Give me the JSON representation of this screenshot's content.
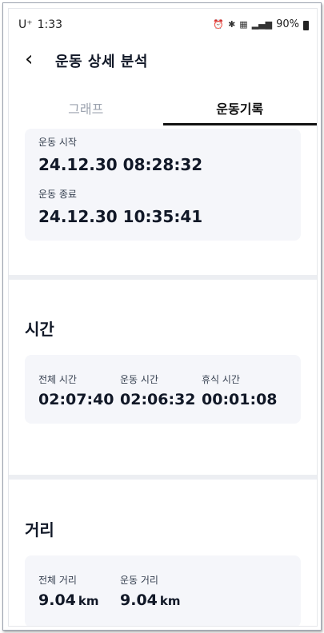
{
  "status_bar": {
    "carrier": "U⁺",
    "time": "1:33",
    "battery": "90%"
  },
  "header": {
    "title": "운동 상세 분석"
  },
  "tabs": [
    {
      "label": "그래프",
      "active": false
    },
    {
      "label": "운동기록",
      "active": true
    }
  ],
  "session": {
    "start_label": "운동 시작",
    "start_value": "24.12.30 08:28:32",
    "end_label": "운동 종료",
    "end_value": "24.12.30 10:35:41"
  },
  "time_section": {
    "title": "시간",
    "items": [
      {
        "label": "전체 시간",
        "value": "02:07:40"
      },
      {
        "label": "운동 시간",
        "value": "02:06:32"
      },
      {
        "label": "휴식 시간",
        "value": "00:01:08"
      }
    ]
  },
  "distance_section": {
    "title": "거리",
    "items": [
      {
        "label": "전체 거리",
        "value": "9.04",
        "unit": "km"
      },
      {
        "label": "운동 거리",
        "value": "9.04",
        "unit": "km"
      }
    ]
  }
}
